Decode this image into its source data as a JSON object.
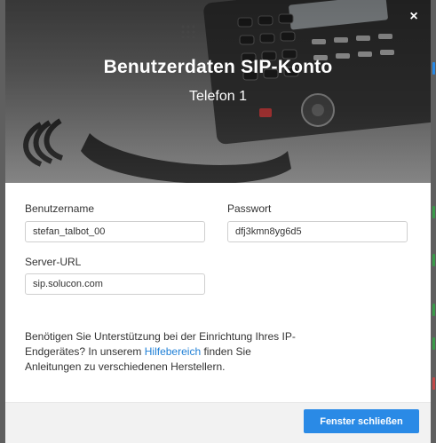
{
  "modal": {
    "title": "Benutzerdaten SIP-Konto",
    "subtitle": "Telefon 1",
    "close_symbol": "×"
  },
  "form": {
    "username": {
      "label": "Benutzername",
      "value": "stefan_talbot_00"
    },
    "password": {
      "label": "Passwort",
      "value": "dfj3kmn8yg6d5"
    },
    "server_url": {
      "label": "Server-URL",
      "value": "sip.solucon.com"
    }
  },
  "help": {
    "text_before": "Benötigen Sie Unterstützung bei der Einrichtung Ihres IP-Endgerätes? In unserem ",
    "link": "Hilfebereich",
    "text_after": " finden Sie Anleitungen zu verschiedenen Herstellern."
  },
  "footer": {
    "close_button": "Fenster schließen"
  },
  "colors": {
    "accent": "#2a8ae6",
    "link": "#1e7fd6"
  }
}
